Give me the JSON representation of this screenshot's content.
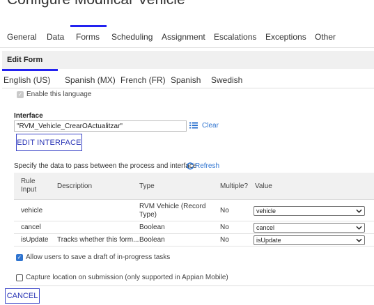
{
  "page": {
    "title": "Configure Modificar Vehicle"
  },
  "main_tabs": [
    {
      "label": "General"
    },
    {
      "label": "Data"
    },
    {
      "label": "Forms"
    },
    {
      "label": "Scheduling"
    },
    {
      "label": "Assignment"
    },
    {
      "label": "Escalations"
    },
    {
      "label": "Exceptions"
    },
    {
      "label": "Other"
    }
  ],
  "active_main_tab": "Forms",
  "edit_form": {
    "label": "Edit Form"
  },
  "language_tabs": [
    {
      "label": "English (US)"
    },
    {
      "label": "Spanish (MX)"
    },
    {
      "label": "French (FR)"
    },
    {
      "label": "Spanish"
    },
    {
      "label": "Swedish"
    }
  ],
  "enable_language": {
    "label": "Enable this language",
    "checked": true,
    "disabled": true
  },
  "interface": {
    "label": "Interface",
    "value": "\"RVM_Vehicle_CrearOActualitzar\"",
    "clear_label": "Clear",
    "edit_button": "EDIT INTERFACE"
  },
  "specify": {
    "text": "Specify the data to pass between the process and interface",
    "refresh_label": "Refresh"
  },
  "table": {
    "headers": [
      "Rule Input",
      "Description",
      "Type",
      "Multiple?",
      "Value"
    ],
    "rows": [
      {
        "rule_input": "vehicle",
        "description": "",
        "type": "RVM Vehicle (Record Type)",
        "multiple": "No",
        "value": "vehicle"
      },
      {
        "rule_input": "cancel",
        "description": "",
        "type": "Boolean",
        "multiple": "No",
        "value": "cancel"
      },
      {
        "rule_input": "isUpdate",
        "description": "Tracks whether this form...",
        "type": "Boolean",
        "multiple": "No",
        "value": "isUpdate"
      }
    ]
  },
  "allow_draft": {
    "label": "Allow users to save a draft of in-progress tasks",
    "checked": true
  },
  "capture_location": {
    "label": "Capture location on submission (only supported in Appian Mobile)",
    "checked": false
  },
  "footer": {
    "cancel_label": "CANCEL"
  },
  "colors": {
    "accent": "#2322f0",
    "link": "#2f74d0",
    "button_border": "#3c46c8"
  },
  "icons": {
    "list": "list-icon",
    "refresh": "refresh-icon",
    "chevron": "chevron-down-icon",
    "check": "checkmark-icon"
  }
}
